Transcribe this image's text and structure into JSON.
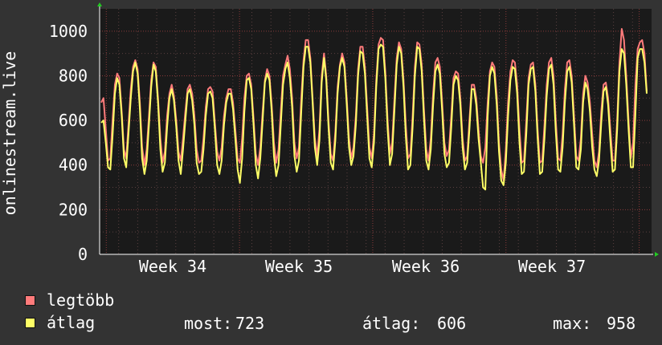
{
  "chart_data": {
    "type": "line",
    "ylabel": "onlinestream.live",
    "ylim": [
      0,
      1100
    ],
    "yticks": [
      0,
      200,
      400,
      600,
      800,
      1000
    ],
    "xticks": [
      "Week 34",
      "Week 35",
      "Week 36",
      "Week 37"
    ],
    "grid": true,
    "series": [
      {
        "name": "legtöbb",
        "color": "#ff7b7b",
        "values": [
          680,
          700,
          560,
          420,
          430,
          600,
          760,
          810,
          790,
          640,
          470,
          430,
          580,
          740,
          840,
          870,
          830,
          680,
          480,
          400,
          470,
          620,
          780,
          860,
          840,
          700,
          520,
          410,
          460,
          620,
          720,
          760,
          710,
          600,
          460,
          420,
          520,
          640,
          740,
          760,
          720,
          620,
          470,
          410,
          420,
          520,
          660,
          740,
          750,
          730,
          590,
          460,
          420,
          480,
          620,
          700,
          740,
          740,
          680,
          560,
          430,
          410,
          520,
          700,
          800,
          810,
          760,
          610,
          450,
          400,
          480,
          640,
          780,
          830,
          800,
          670,
          500,
          410,
          470,
          640,
          800,
          850,
          890,
          830,
          700,
          500,
          430,
          480,
          700,
          870,
          960,
          960,
          880,
          700,
          520,
          440,
          560,
          800,
          900,
          800,
          600,
          450,
          420,
          550,
          750,
          850,
          900,
          860,
          700,
          520,
          430,
          480,
          620,
          830,
          930,
          930,
          840,
          660,
          480,
          430,
          540,
          780,
          940,
          970,
          960,
          820,
          600,
          450,
          500,
          700,
          880,
          950,
          920,
          780,
          580,
          430,
          450,
          620,
          840,
          950,
          940,
          850,
          650,
          470,
          420,
          520,
          720,
          860,
          880,
          840,
          680,
          500,
          440,
          470,
          620,
          790,
          820,
          810,
          700,
          520,
          420,
          440,
          600,
          760,
          760,
          700,
          560,
          440,
          410,
          480,
          680,
          820,
          860,
          840,
          710,
          500,
          380,
          330,
          470,
          680,
          820,
          870,
          860,
          760,
          560,
          410,
          420,
          600,
          790,
          850,
          860,
          760,
          560,
          410,
          420,
          580,
          760,
          860,
          880,
          800,
          600,
          430,
          420,
          540,
          740,
          860,
          870,
          800,
          620,
          440,
          420,
          520,
          720,
          800,
          770,
          680,
          540,
          420,
          390,
          460,
          640,
          760,
          770,
          700,
          560,
          420,
          420,
          600,
          860,
          1010,
          960,
          800,
          600,
          430,
          500,
          760,
          920,
          950,
          960,
          900,
          730
        ]
      },
      {
        "name": "átlag",
        "color": "#ffff66",
        "values": [
          590,
          600,
          500,
          390,
          380,
          530,
          720,
          790,
          760,
          620,
          430,
          390,
          540,
          700,
          820,
          860,
          810,
          650,
          430,
          360,
          420,
          580,
          750,
          850,
          820,
          680,
          470,
          370,
          410,
          570,
          700,
          740,
          690,
          570,
          420,
          360,
          470,
          600,
          720,
          740,
          690,
          580,
          410,
          360,
          370,
          470,
          620,
          720,
          730,
          700,
          560,
          400,
          360,
          420,
          580,
          680,
          720,
          720,
          650,
          520,
          380,
          320,
          430,
          640,
          780,
          790,
          740,
          580,
          400,
          340,
          430,
          600,
          770,
          810,
          780,
          640,
          440,
          350,
          400,
          580,
          760,
          830,
          860,
          790,
          660,
          440,
          370,
          420,
          640,
          840,
          930,
          930,
          860,
          680,
          480,
          400,
          510,
          770,
          880,
          780,
          570,
          410,
          380,
          510,
          720,
          840,
          880,
          840,
          670,
          480,
          400,
          440,
          580,
          800,
          910,
          900,
          810,
          620,
          430,
          390,
          500,
          750,
          920,
          940,
          930,
          790,
          560,
          400,
          450,
          650,
          850,
          930,
          900,
          750,
          530,
          380,
          400,
          570,
          800,
          930,
          920,
          820,
          610,
          420,
          380,
          470,
          670,
          820,
          850,
          810,
          640,
          450,
          390,
          410,
          570,
          760,
          800,
          780,
          670,
          480,
          380,
          410,
          560,
          740,
          740,
          670,
          520,
          410,
          300,
          290,
          620,
          800,
          840,
          810,
          670,
          460,
          330,
          310,
          410,
          620,
          780,
          840,
          830,
          720,
          500,
          360,
          370,
          540,
          760,
          830,
          840,
          730,
          520,
          360,
          370,
          520,
          710,
          830,
          850,
          760,
          550,
          380,
          370,
          480,
          680,
          820,
          840,
          770,
          580,
          390,
          380,
          470,
          680,
          770,
          740,
          640,
          480,
          380,
          350,
          420,
          590,
          730,
          750,
          670,
          510,
          370,
          380,
          560,
          820,
          920,
          900,
          760,
          560,
          390,
          390,
          630,
          880,
          920,
          920,
          860,
          720
        ]
      }
    ]
  },
  "legend": [
    {
      "label": "legtöbb",
      "color": "#ff7b7b"
    },
    {
      "label": "átlag",
      "color": "#ffff66"
    }
  ],
  "stats": {
    "most_label": "most:",
    "most_value": "723",
    "atlag_label": "átlag:",
    "atlag_value": "606",
    "max_label": "max:",
    "max_value": "958"
  }
}
